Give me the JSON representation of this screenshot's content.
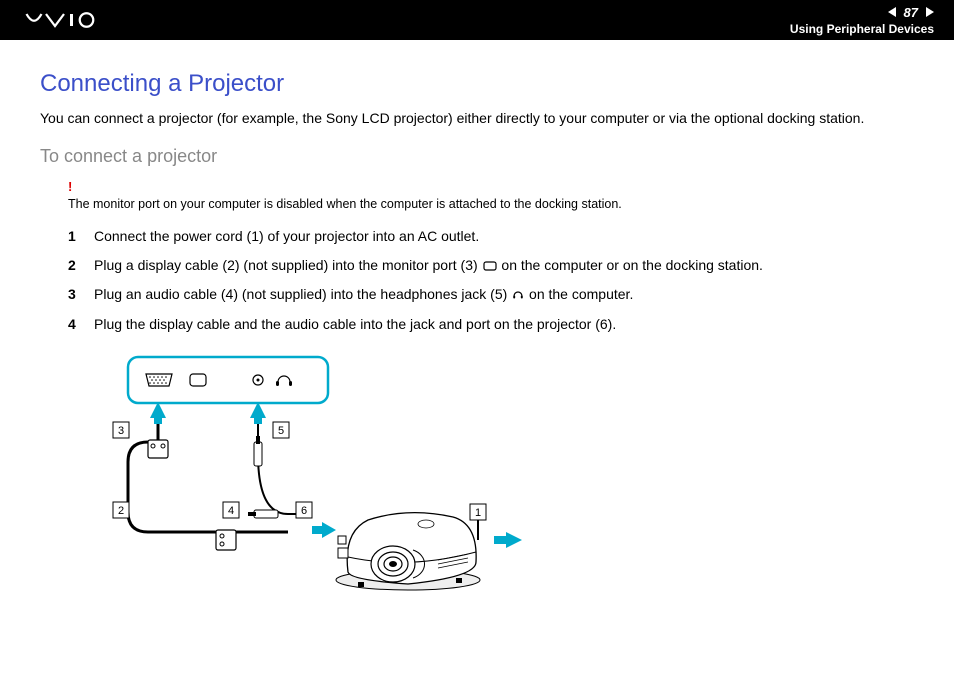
{
  "header": {
    "logo_alt": "VAIO",
    "page_number": "87",
    "section": "Using Peripheral Devices"
  },
  "content": {
    "title": "Connecting a Projector",
    "intro": "You can connect a projector (for example, the Sony LCD projector) either directly to your computer or via the optional docking station.",
    "subheading": "To connect a projector",
    "note_mark": "!",
    "note_text": "The monitor port on your computer is disabled when the computer is attached to the docking station.",
    "steps": [
      {
        "num": "1",
        "text_a": "Connect the power cord (1) of your projector into an AC outlet."
      },
      {
        "num": "2",
        "text_a": "Plug a display cable (2) (not supplied) into the monitor port (3) ",
        "text_b": " on the computer or on the docking station."
      },
      {
        "num": "3",
        "text_a": "Plug an audio cable (4) (not supplied) into the headphones jack (5) ",
        "text_b": " on the computer."
      },
      {
        "num": "4",
        "text_a": "Plug the display cable and the audio cable into the jack and port on the projector (6)."
      }
    ]
  },
  "diagram": {
    "labels": [
      "1",
      "2",
      "3",
      "4",
      "5",
      "6"
    ]
  }
}
